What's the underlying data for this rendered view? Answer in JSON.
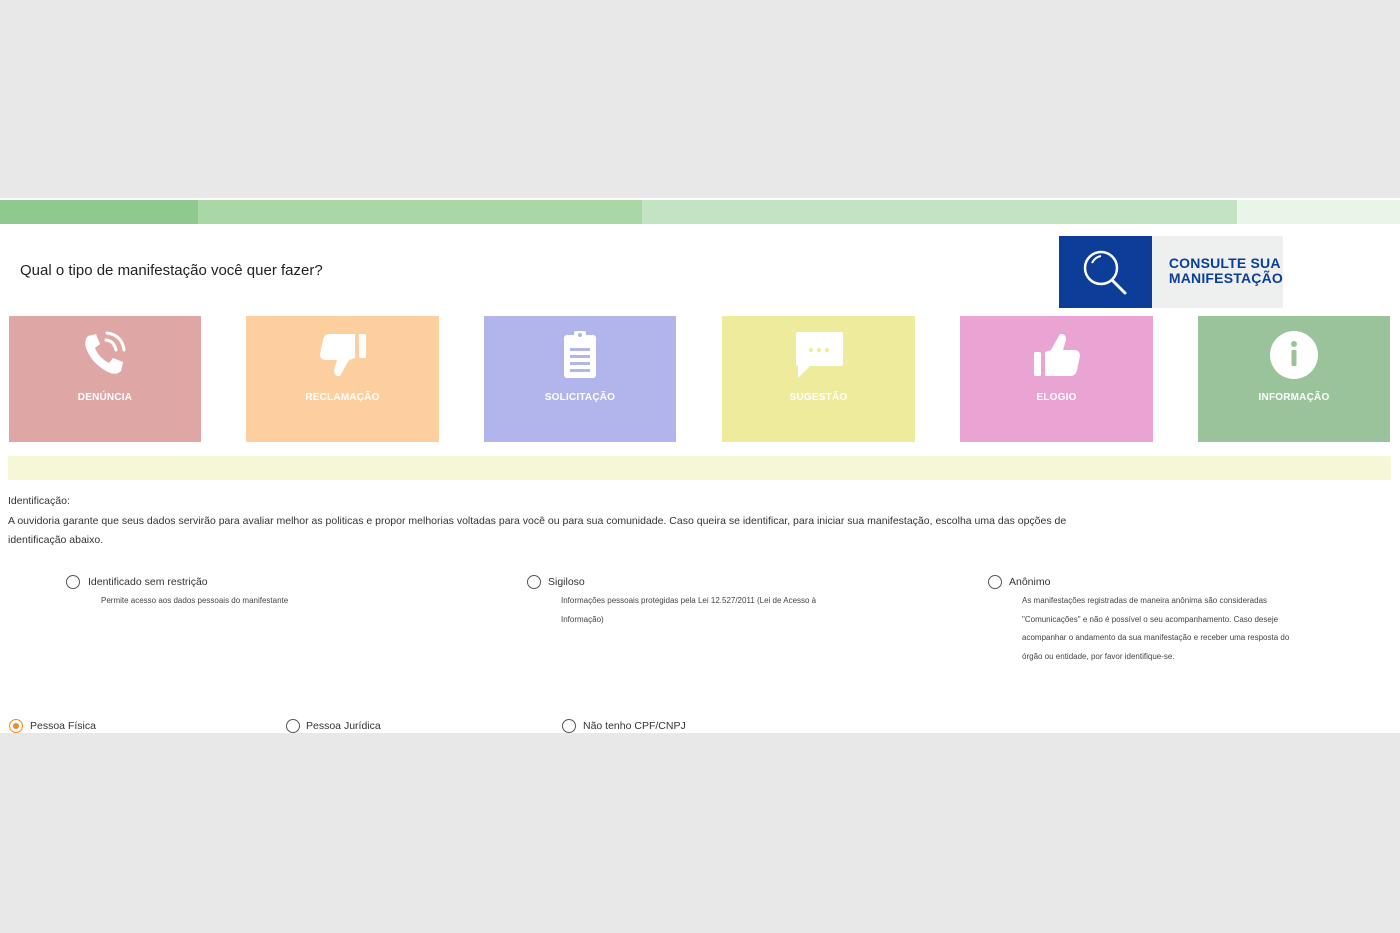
{
  "progress": {
    "segments": 4
  },
  "header": {
    "question": "Qual o tipo de manifestação você quer fazer?",
    "consult_line1": "CONSULTE SUA",
    "consult_line2": "MANIFESTAÇÃO",
    "consult_icon": "search-icon"
  },
  "cards": [
    {
      "label": "DENÚNCIA",
      "icon": "phone-icon",
      "color": "#dea7a6"
    },
    {
      "label": "RECLAMAÇÃO",
      "icon": "thumbs-down-icon",
      "color": "#fdcf9e"
    },
    {
      "label": "SOLICITAÇÃO",
      "icon": "clipboard-icon",
      "color": "#b2b5eb"
    },
    {
      "label": "SUGESTÃO",
      "icon": "chat-bubble-icon",
      "color": "#eeeb9c"
    },
    {
      "label": "ELOGIO",
      "icon": "thumbs-up-icon",
      "color": "#e9a4d3"
    },
    {
      "label": "INFORMAÇÃO",
      "icon": "info-icon",
      "color": "#9bc39b"
    }
  ],
  "identification": {
    "title": "Identificação:",
    "text": "A ouvidoria garante que seus dados servirão para avaliar melhor as politicas e propor melhorias voltadas para você ou para sua comunidade. Caso queira se identificar, para iniciar sua manifestação, escolha uma das opções de identificação abaixo.",
    "options": [
      {
        "label": "Identificado sem restrição",
        "description": "Permite acesso aos dados pessoais do manifestante"
      },
      {
        "label": "Sigiloso",
        "description": "Informações pessoais protegidas pela Lei 12.527/2011 (Lei de Acesso à Informação)"
      },
      {
        "label": "Anônimo",
        "description": "As manifestações registradas de maneira anônima são consideradas \"Comunicações\" e não é possível o seu acompanhamento. Caso deseje acompanhar o andamento da sua manifestação e receber uma resposta do órgão ou entidade, por favor identifique-se."
      }
    ]
  },
  "person_type": {
    "options": [
      {
        "label": "Pessoa Física",
        "selected": true
      },
      {
        "label": "Pessoa Jurídica",
        "selected": false
      },
      {
        "label": "Não tenho CPF/CNPJ",
        "selected": false
      }
    ],
    "accent": "#f08a24"
  },
  "colors": {
    "consult_blue": "#0b3d99",
    "notice_bg": "#f6f7d6"
  }
}
